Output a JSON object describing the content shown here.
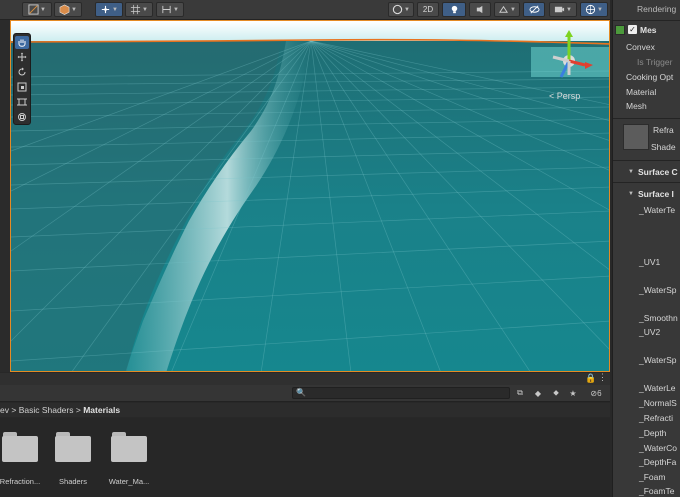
{
  "toolbar": {
    "left_tools": [
      {
        "icon": "draw-mode-icon"
      },
      {
        "icon": "shaded-cube-icon"
      },
      {
        "icon": "transform-space-icon"
      },
      {
        "icon": "grid-snap-icon"
      },
      {
        "icon": "increment-snap-icon"
      }
    ],
    "right_tools": [
      {
        "icon": "shading-sphere-icon"
      },
      {
        "label": "2D"
      },
      {
        "icon": "lighting-icon"
      },
      {
        "icon": "audio-icon"
      },
      {
        "icon": "effects-icon"
      },
      {
        "icon": "hidden-objects-icon"
      },
      {
        "icon": "camera-icon"
      },
      {
        "icon": "gizmos-icon"
      }
    ]
  },
  "scene": {
    "camera_mode": "< Persp",
    "tools": [
      "hand-tool-icon",
      "move-tool-icon",
      "rotate-tool-icon",
      "scale-tool-icon",
      "rect-tool-icon",
      "transform-tool-icon"
    ],
    "colors": {
      "sky": "#e6f4f6",
      "water": "#1a7f86",
      "horizon": "#e8731f",
      "selection": "#e58a23"
    }
  },
  "project": {
    "search_placeholder": "🔍",
    "hidden_count": "6",
    "breadcrumb": {
      "prefix": "ev",
      "parent": "Basic Shaders",
      "current": "Materials"
    },
    "files": [
      {
        "label": "Refraction..."
      },
      {
        "label": "Shaders"
      },
      {
        "label": "Water_Ma..."
      }
    ]
  },
  "inspector": {
    "header": "Rendering",
    "component": "Mes",
    "rows": [
      {
        "label": "Convex",
        "dim": false
      },
      {
        "label": "Is Trigger",
        "dim": true
      },
      {
        "label": "Cooking Opt",
        "dim": false
      },
      {
        "label": "Material",
        "dim": false
      },
      {
        "label": "Mesh",
        "dim": false
      }
    ],
    "material_name": "Refra",
    "material_shader": "Shade",
    "sections": [
      "Surface C",
      "Surface I"
    ],
    "properties": [
      "_WaterTe",
      "_UV1",
      "_WaterSp",
      "_Smoothn",
      "_UV2",
      "_WaterSp",
      "_WaterLe",
      "_NormalS",
      "_Refracti",
      "_Depth",
      "_WaterCo",
      "_DepthFa",
      "_Foam",
      "_FoamTe"
    ]
  }
}
